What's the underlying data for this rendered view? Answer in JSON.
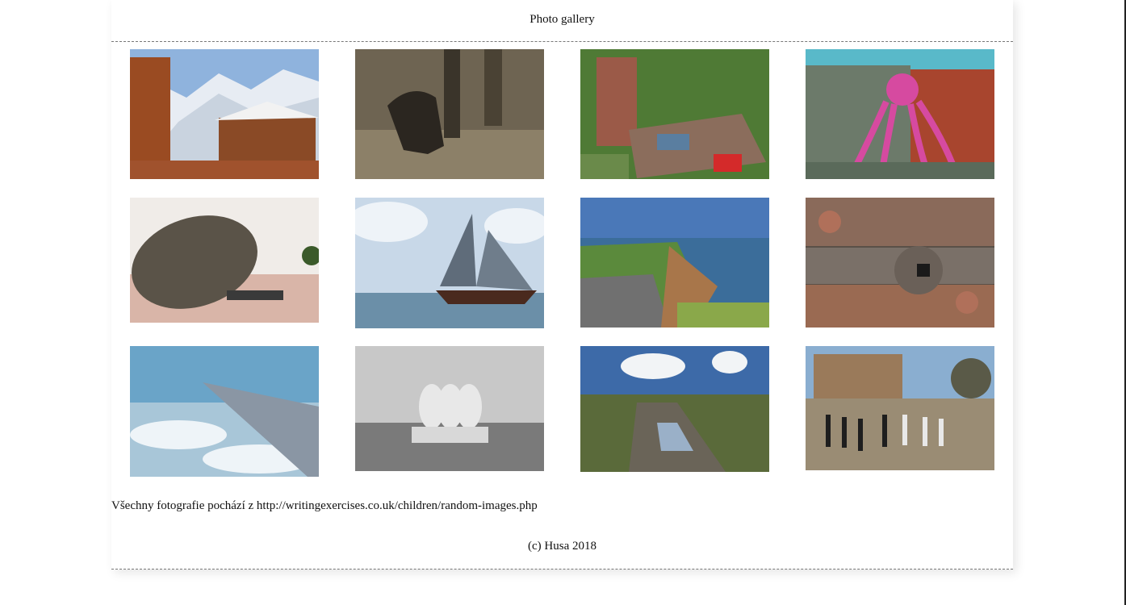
{
  "header": {
    "title": "Photo gallery"
  },
  "gallery": {
    "images": [
      {
        "name": "photo-mountain-chalets",
        "scene": "Snowy mountains with wooden chalets"
      },
      {
        "name": "photo-dog-in-grass",
        "scene": "Sepia dog running through grass"
      },
      {
        "name": "photo-collapsed-wall",
        "scene": "Collapsed brick wall with rubble and car"
      },
      {
        "name": "photo-octopus-building",
        "scene": "Giant inflatable octopus in front of a building"
      },
      {
        "name": "photo-balancing-boulder",
        "scene": "Huge balancing boulder with people underneath"
      },
      {
        "name": "photo-sailing-ship",
        "scene": "Sailing ship on calm sea"
      },
      {
        "name": "photo-eroded-cliff-road",
        "scene": "Road falling off an eroded cliff by the sea"
      },
      {
        "name": "photo-bug-hotel",
        "scene": "Insect hotel with pipes and logs"
      },
      {
        "name": "photo-airplane-wing",
        "scene": "Airplane wing above clouds"
      },
      {
        "name": "photo-three-monkeys",
        "scene": "Three wise monkeys sculpture"
      },
      {
        "name": "photo-muddy-road",
        "scene": "Muddy country lane with puddles"
      },
      {
        "name": "photo-giant-chess",
        "scene": "Giant chess set in front of a manor"
      }
    ]
  },
  "note": {
    "text": "Všechny fotografie pochází z http://writingexercises.co.uk/children/random-images.php"
  },
  "footer": {
    "text": "(c) Husa 2018"
  }
}
